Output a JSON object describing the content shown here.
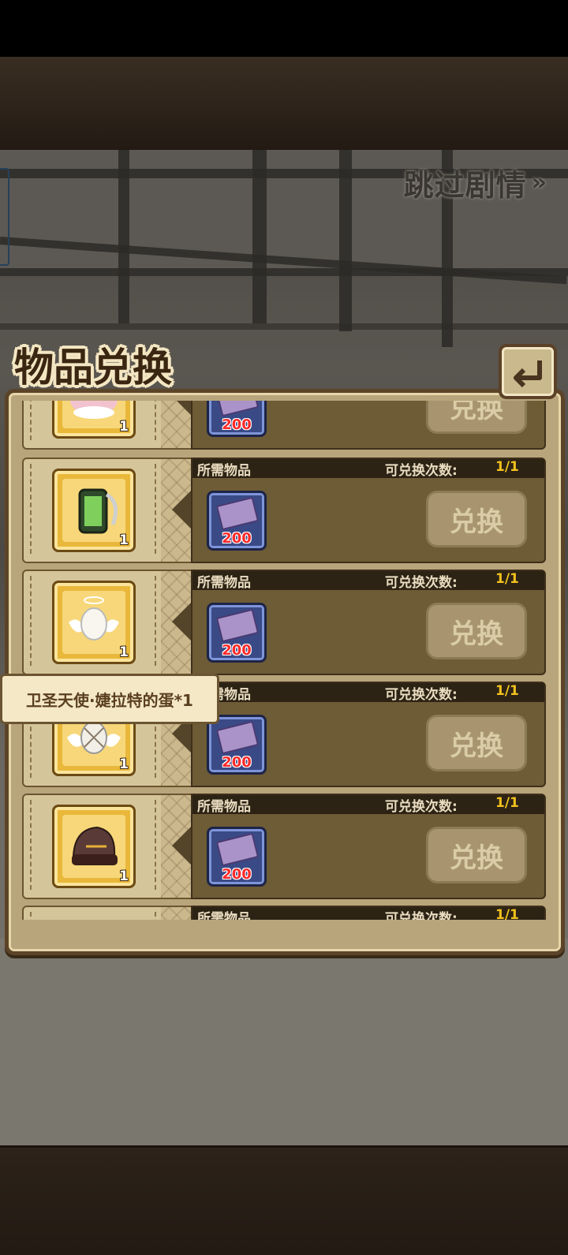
{
  "header": {
    "skip_label": "跳过剧情",
    "skip_arrow": "»"
  },
  "dialog": {
    "title": "物品兑换",
    "back_icon": "return-arrow-icon",
    "columns": {
      "required": "所需物品",
      "count_label": "可兑换次数:"
    },
    "rows": [
      {
        "item_icon": "pink-creature-icon",
        "item_qty": "1",
        "cost": "200",
        "count": "",
        "button": "兑换"
      },
      {
        "item_icon": "green-canister-icon",
        "item_qty": "1",
        "cost": "200",
        "count": "1/1",
        "button": "兑换"
      },
      {
        "item_icon": "angel-egg-icon",
        "item_qty": "1",
        "cost": "200",
        "count": "1/1",
        "button": "兑换"
      },
      {
        "item_icon": "winged-egg-icon",
        "item_qty": "1",
        "cost": "200",
        "count": "1/1",
        "button": "兑换"
      },
      {
        "item_icon": "dark-helmet-icon",
        "item_qty": "1",
        "cost": "200",
        "count": "1/1",
        "button": "兑换"
      },
      {
        "item_icon": "item-icon",
        "item_qty": "",
        "cost": "",
        "count": "1/1",
        "button": ""
      }
    ],
    "cost_icon": "purple-ticket-icon"
  },
  "tooltip": {
    "text": "卫圣天使·婕拉特的蛋*1"
  },
  "colors": {
    "gold": "#f2c21b",
    "cost_red": "#ff2a2a",
    "panel": "#b9a57b",
    "frame": "#5c4428"
  }
}
